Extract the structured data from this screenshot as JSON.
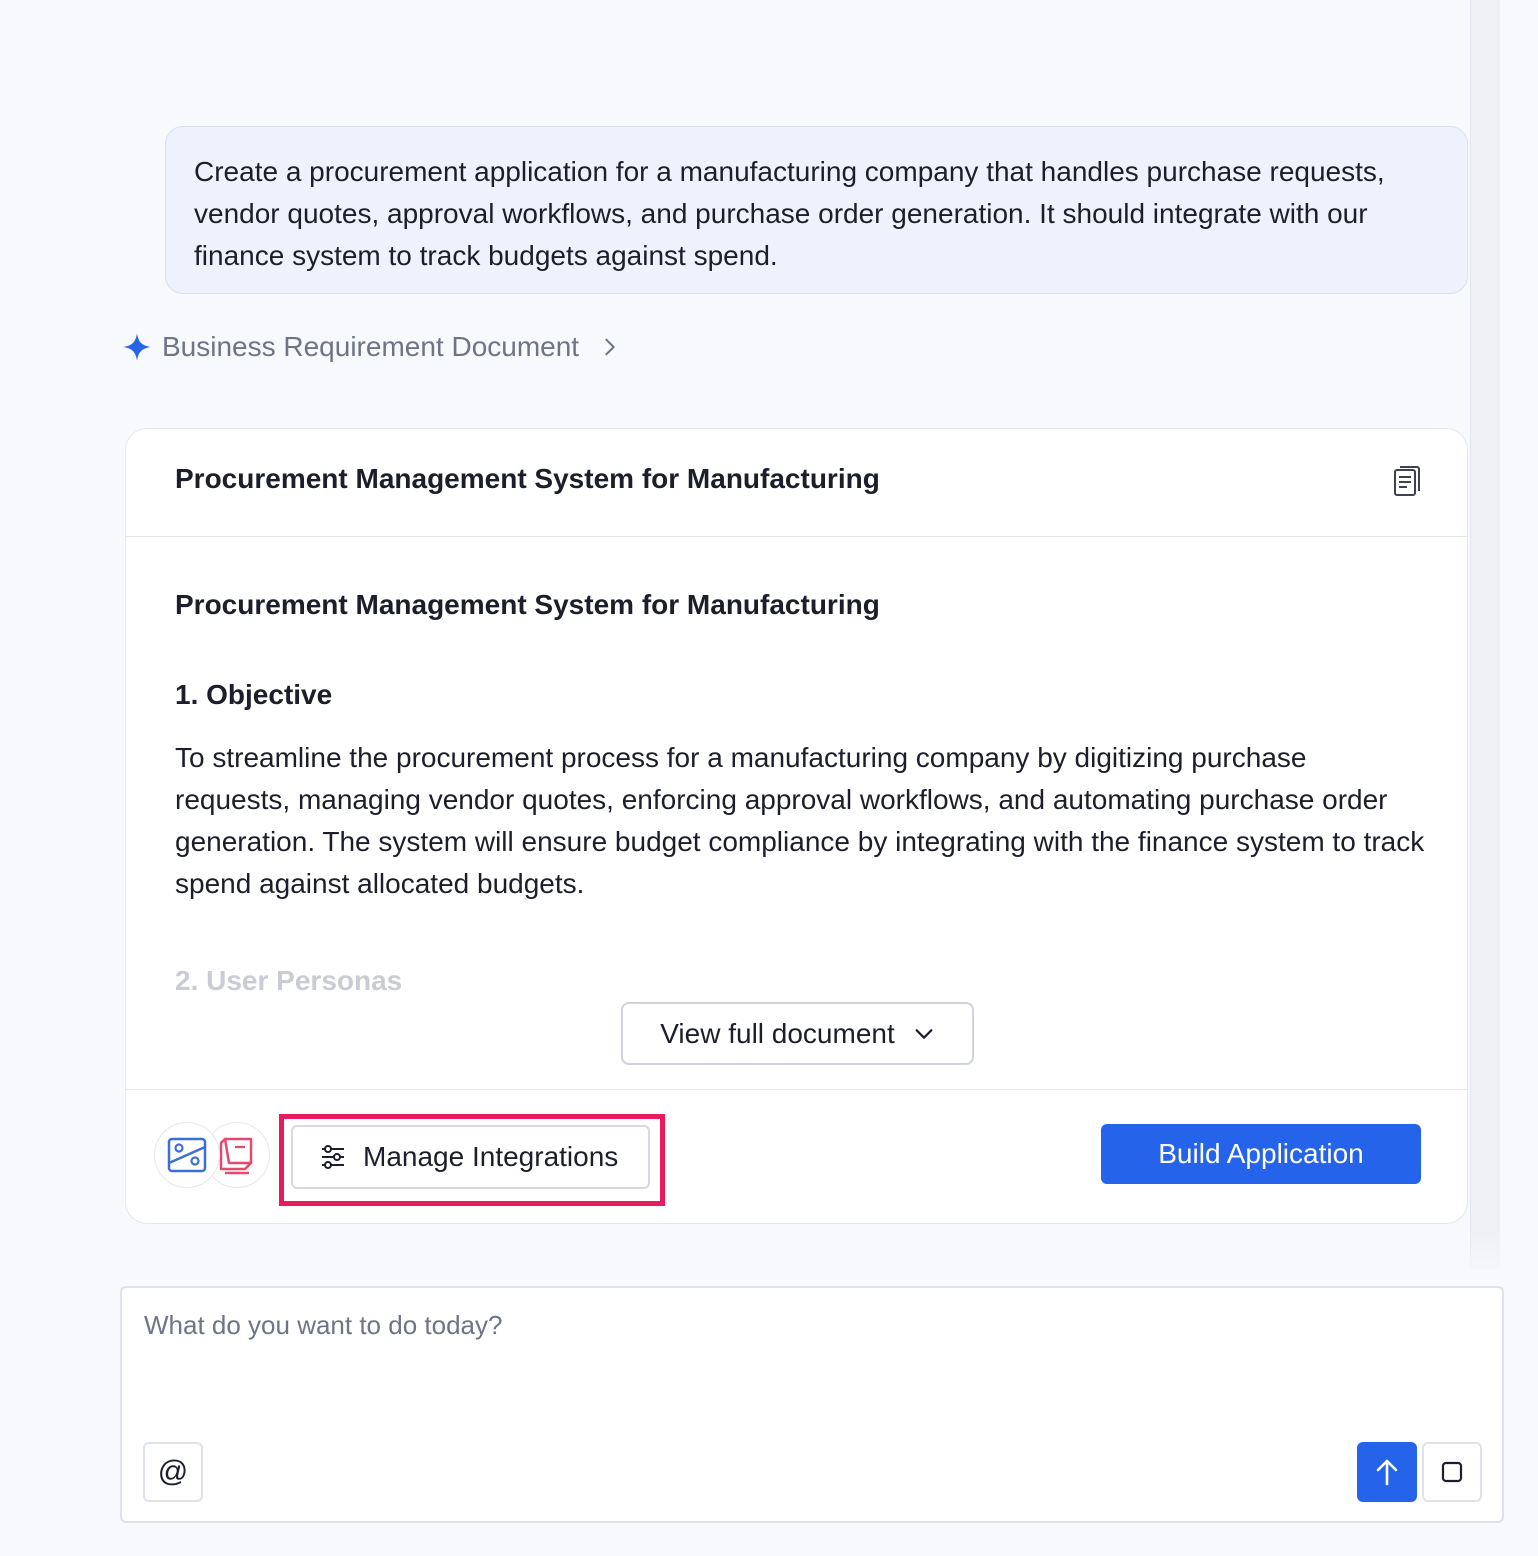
{
  "user_message": {
    "text": "Create a procurement application for a manufacturing company that handles purchase requests, vendor quotes, approval workflows, and purchase order generation. It should integrate with our finance system to track budgets against spend."
  },
  "brd_link": {
    "label": "Business Requirement Document",
    "icon": "sparkle-icon",
    "accent_color": "#2563eb"
  },
  "document": {
    "header_title": "Procurement Management System for Manufacturing",
    "header_icon": "document-icon",
    "body_title": "Procurement Management System for Manufacturing",
    "sections": [
      {
        "heading": "1. Objective",
        "text": "To streamline the procurement process for a manufacturing company by digitizing purchase requests, managing vendor quotes, enforcing approval workflows, and automating purchase order generation. The system will ensure budget compliance by integrating with the finance system to track spend against allocated budgets."
      },
      {
        "heading": "2. User Personas"
      }
    ],
    "view_full_label": "View full document"
  },
  "footer": {
    "integrations": [
      {
        "icon": "finance-integration-icon",
        "color": "#3b6fd8"
      },
      {
        "icon": "procurement-integration-icon",
        "color": "#e64a6b"
      }
    ],
    "manage_label": "Manage Integrations",
    "build_label": "Build Application",
    "highlight_color": "#ea1b5d"
  },
  "composer": {
    "placeholder": "What do you want to do today?",
    "mention_label": "@"
  }
}
